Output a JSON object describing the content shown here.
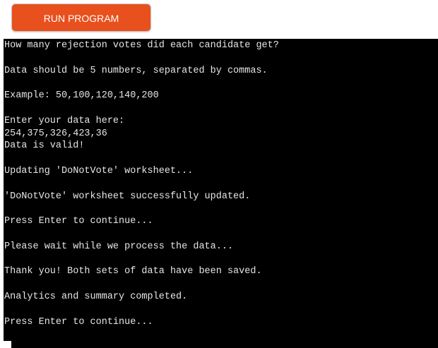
{
  "toolbar": {
    "run_label": "RUN PROGRAM"
  },
  "colors": {
    "run_button": "#e8501d",
    "terminal_bg": "#000000",
    "terminal_text": "#e6e6e6"
  },
  "terminal": {
    "lines": [
      "How many rejection votes did each candidate get?",
      "",
      "Data should be 5 numbers, separated by commas.",
      "",
      "Example: 50,100,120,140,200",
      "",
      "Enter your data here:",
      "254,375,326,423,36",
      "Data is valid!",
      "",
      "Updating 'DoNotVote' worksheet...",
      "",
      "'DoNotVote' worksheet successfully updated.",
      "",
      "Press Enter to continue...",
      "",
      "Please wait while we process the data...",
      "",
      "Thank you! Both sets of data have been saved.",
      "",
      "Analytics and summary completed.",
      "",
      "Press Enter to continue..."
    ]
  }
}
